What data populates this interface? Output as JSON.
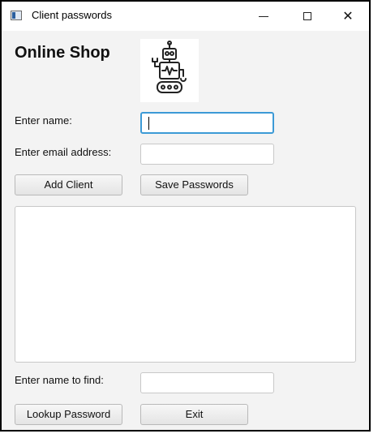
{
  "window": {
    "title": "Client passwords",
    "controls": {
      "minimize": "—",
      "maximize": "☐",
      "close": "✕"
    }
  },
  "header": {
    "title": "Online Shop",
    "logo_icon": "robot-icon"
  },
  "form": {
    "name_label": "Enter name:",
    "name_value": "",
    "email_label": "Enter email address:",
    "email_value": ""
  },
  "actions": {
    "add_client": "Add Client",
    "save_passwords": "Save Passwords"
  },
  "output": {
    "text": ""
  },
  "lookup": {
    "find_label": "Enter name to find:",
    "find_value": "",
    "lookup_button": "Lookup Password",
    "exit_button": "Exit"
  },
  "colors": {
    "focus_border": "#3c9ad6",
    "window_bg": "#f3f3f3"
  }
}
